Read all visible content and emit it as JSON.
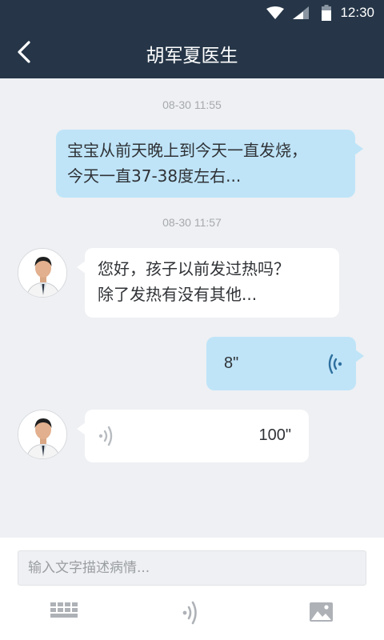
{
  "status_bar": {
    "time": "12:30"
  },
  "nav": {
    "title": "胡军夏医生"
  },
  "chat": {
    "messages": [
      {
        "timestamp": "08-30 11:55"
      },
      {
        "text_line1": "宝宝从前天晚上到今天一直发烧，",
        "text_line2": "今天一直37-38度左右..."
      },
      {
        "timestamp": "08-30 11:57"
      },
      {
        "text_line1": "您好，孩子以前发过热吗？",
        "text_line2": "除了发热有没有其他..."
      },
      {
        "duration": "8\""
      },
      {
        "duration": "100\""
      }
    ]
  },
  "input": {
    "placeholder": "输入文字描述病情..."
  },
  "colors": {
    "header": "#263648",
    "outgoing_bubble": "#bfe4f8",
    "incoming_bubble": "#ffffff",
    "background": "#eef0f3",
    "voice_icon_out": "#2e6f9e",
    "voice_icon_in": "#b8bcc1"
  }
}
